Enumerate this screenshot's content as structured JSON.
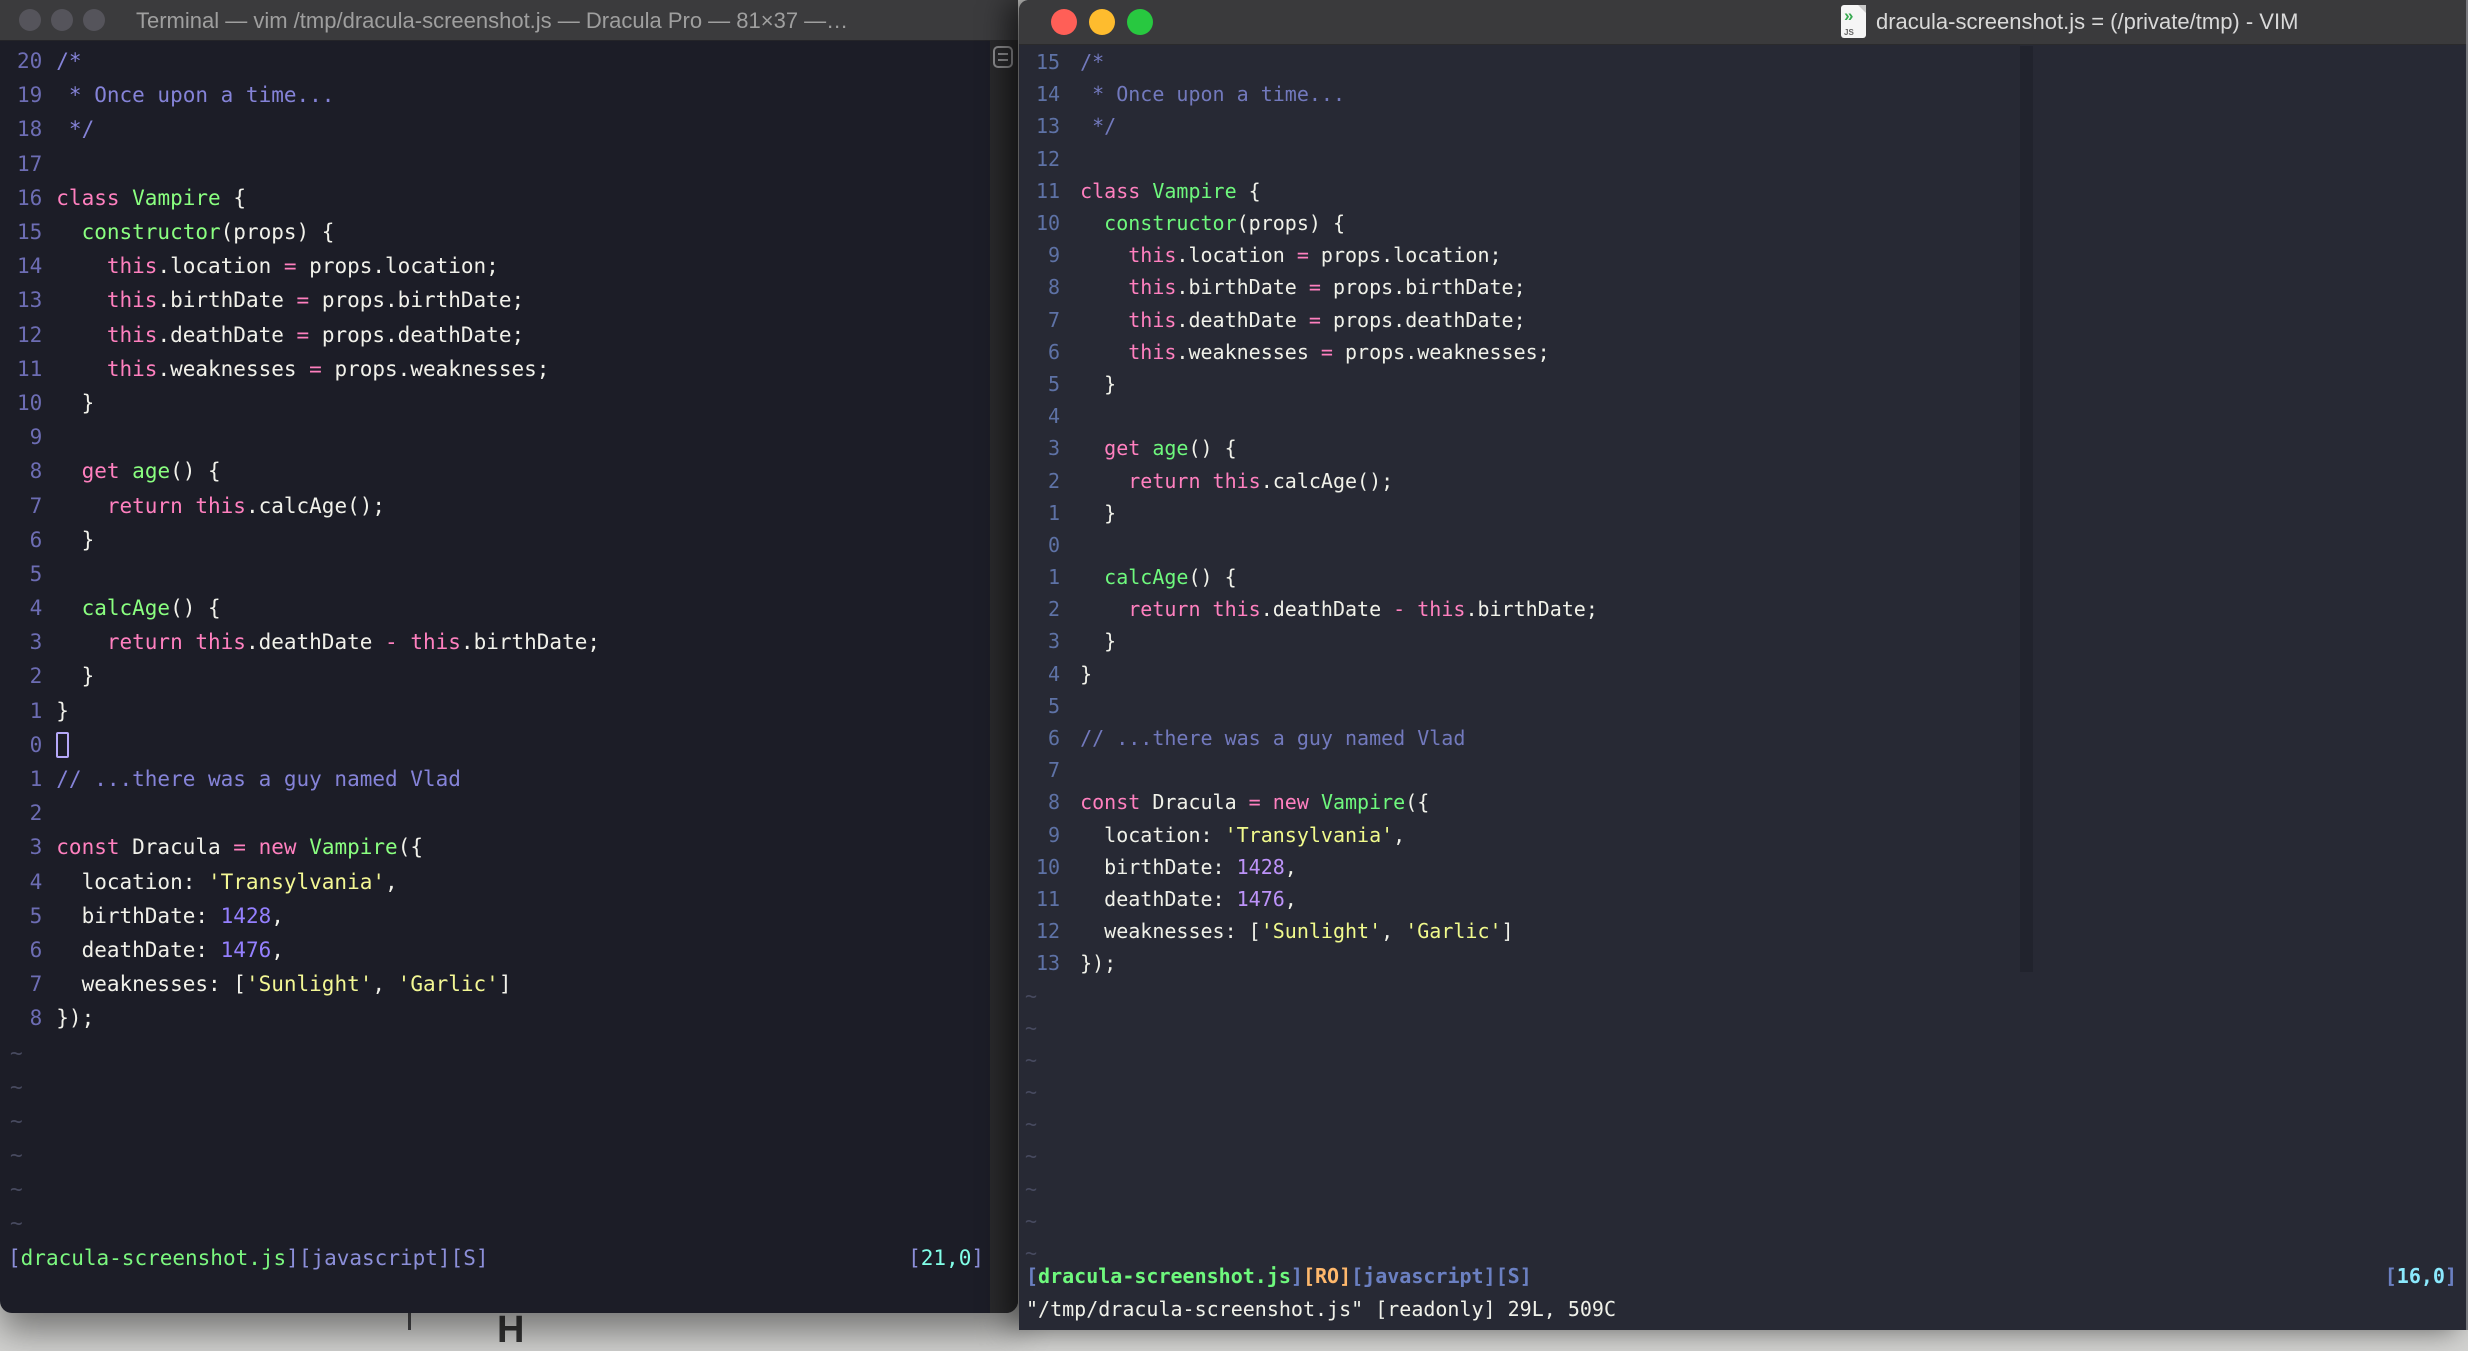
{
  "desktop": {
    "partial_text": "H"
  },
  "palette": {
    "left_bg": "#1c1d27",
    "right_bg": "#272934",
    "titlebar": "#3a3a3d",
    "pink": "#ff80bf",
    "green_left": "#8aff80",
    "green_right": "#6ef87d",
    "yellow_left": "#f3f794",
    "yellow_right": "#f1fa8c",
    "purple_left": "#9580ff",
    "purple_right": "#bd93f9",
    "comment_left": "#8583d8",
    "comment_right": "#7279bd",
    "linenr_left": "#6d6db4",
    "linenr_right": "#5e72a6",
    "cyan_left": "#82ffe8",
    "cyan_right": "#8be9fd",
    "orange": "#ffb86c",
    "traffic_red": "#ff5f57",
    "traffic_yellow": "#febc2e",
    "traffic_green": "#28c840",
    "inactive_light": "#55545b"
  },
  "left_window": {
    "title": "Terminal — vim /tmp/dracula-screenshot.js — Dracula Pro — 81×37 —…",
    "traffic_lights": [
      "#55545b",
      "#55545b",
      "#55545b"
    ],
    "gutter": [
      "20",
      "19",
      "18",
      "17",
      "16",
      "15",
      "14",
      "13",
      "12",
      "11",
      "10",
      "9",
      "8",
      "7",
      "6",
      "5",
      "4",
      "3",
      "2",
      "1",
      "0",
      "1",
      "2",
      "3",
      "4",
      "5",
      "6",
      "7",
      "8"
    ],
    "cursor_row": 20,
    "tilde_count": 6,
    "status_left": [
      [
        "br",
        "["
      ],
      [
        "fn",
        "dracula-screenshot.js"
      ],
      [
        "br",
        "]"
      ],
      [
        "lbl",
        "[javascript][S]"
      ]
    ],
    "status_right": [
      [
        "br",
        "["
      ],
      [
        "cy",
        "21,0"
      ],
      [
        "br",
        "]"
      ]
    ]
  },
  "right_window": {
    "title": "dracula-screenshot.js = (/private/tmp) - VIM",
    "icon_mark": "»",
    "icon_label": "JS",
    "traffic_lights": [
      "#ff5f57",
      "#febc2e",
      "#28c840"
    ],
    "gutter": [
      "15",
      "14",
      "13",
      "12",
      "11",
      "10",
      "9",
      "8",
      "7",
      "6",
      "5",
      "4",
      "3",
      "2",
      "1",
      "0",
      "1",
      "2",
      "3",
      "4",
      "5",
      "6",
      "7",
      "8",
      "9",
      "10",
      "11",
      "12",
      "13"
    ],
    "cursor_row": 15,
    "tilde_count": 9,
    "status_left": [
      [
        "br",
        "["
      ],
      [
        "fn",
        "dracula-screenshot.js"
      ],
      [
        "br",
        "]"
      ],
      [
        "ro",
        "[RO]"
      ],
      [
        "lbl",
        "[javascript][S]"
      ]
    ],
    "status_right": [
      [
        "br",
        "["
      ],
      [
        "cy",
        "16,0"
      ],
      [
        "br",
        "]"
      ]
    ],
    "cmdline": "\"/tmp/dracula-screenshot.js\" [readonly] 29L, 509C"
  },
  "code_lines": [
    [
      [
        "c",
        "/*"
      ]
    ],
    [
      [
        "c",
        " * Once upon a time..."
      ]
    ],
    [
      [
        "c",
        " */"
      ]
    ],
    [],
    [
      [
        "k",
        "class"
      ],
      [
        "p",
        " "
      ],
      [
        "f",
        "Vampire"
      ],
      [
        "p",
        " {"
      ]
    ],
    [
      [
        "p",
        "  "
      ],
      [
        "f",
        "constructor"
      ],
      [
        "p",
        "(props) {"
      ]
    ],
    [
      [
        "p",
        "    "
      ],
      [
        "k",
        "this"
      ],
      [
        "p",
        ".location "
      ],
      [
        "k",
        "="
      ],
      [
        "p",
        " props.location;"
      ]
    ],
    [
      [
        "p",
        "    "
      ],
      [
        "k",
        "this"
      ],
      [
        "p",
        ".birthDate "
      ],
      [
        "k",
        "="
      ],
      [
        "p",
        " props.birthDate;"
      ]
    ],
    [
      [
        "p",
        "    "
      ],
      [
        "k",
        "this"
      ],
      [
        "p",
        ".deathDate "
      ],
      [
        "k",
        "="
      ],
      [
        "p",
        " props.deathDate;"
      ]
    ],
    [
      [
        "p",
        "    "
      ],
      [
        "k",
        "this"
      ],
      [
        "p",
        ".weaknesses "
      ],
      [
        "k",
        "="
      ],
      [
        "p",
        " props.weaknesses;"
      ]
    ],
    [
      [
        "p",
        "  }"
      ]
    ],
    [],
    [
      [
        "p",
        "  "
      ],
      [
        "k",
        "get"
      ],
      [
        "p",
        " "
      ],
      [
        "f",
        "age"
      ],
      [
        "p",
        "() {"
      ]
    ],
    [
      [
        "p",
        "    "
      ],
      [
        "k",
        "return"
      ],
      [
        "p",
        " "
      ],
      [
        "k",
        "this"
      ],
      [
        "p",
        ".calcAge();"
      ]
    ],
    [
      [
        "p",
        "  }"
      ]
    ],
    [],
    [
      [
        "p",
        "  "
      ],
      [
        "f",
        "calcAge"
      ],
      [
        "p",
        "() {"
      ]
    ],
    [
      [
        "p",
        "    "
      ],
      [
        "k",
        "return"
      ],
      [
        "p",
        " "
      ],
      [
        "k",
        "this"
      ],
      [
        "p",
        ".deathDate "
      ],
      [
        "k",
        "-"
      ],
      [
        "p",
        " "
      ],
      [
        "k",
        "this"
      ],
      [
        "p",
        ".birthDate;"
      ]
    ],
    [
      [
        "p",
        "  }"
      ]
    ],
    [
      [
        "p",
        "}"
      ]
    ],
    [],
    [
      [
        "c",
        "// ...there was a guy named Vlad"
      ]
    ],
    [],
    [
      [
        "k",
        "const"
      ],
      [
        "p",
        " Dracula "
      ],
      [
        "k",
        "="
      ],
      [
        "p",
        " "
      ],
      [
        "k",
        "new"
      ],
      [
        "p",
        " "
      ],
      [
        "f",
        "Vampire"
      ],
      [
        "p",
        "({"
      ]
    ],
    [
      [
        "p",
        "  location: "
      ],
      [
        "s",
        "'Transylvania'"
      ],
      [
        "p",
        ","
      ]
    ],
    [
      [
        "p",
        "  birthDate: "
      ],
      [
        "n",
        "1428"
      ],
      [
        "p",
        ","
      ]
    ],
    [
      [
        "p",
        "  deathDate: "
      ],
      [
        "n",
        "1476"
      ],
      [
        "p",
        ","
      ]
    ],
    [
      [
        "p",
        "  weaknesses: ["
      ],
      [
        "s",
        "'Sunlight'"
      ],
      [
        "p",
        ", "
      ],
      [
        "s",
        "'Garlic'"
      ],
      [
        "p",
        "]"
      ]
    ],
    [
      [
        "p",
        "});"
      ]
    ]
  ]
}
